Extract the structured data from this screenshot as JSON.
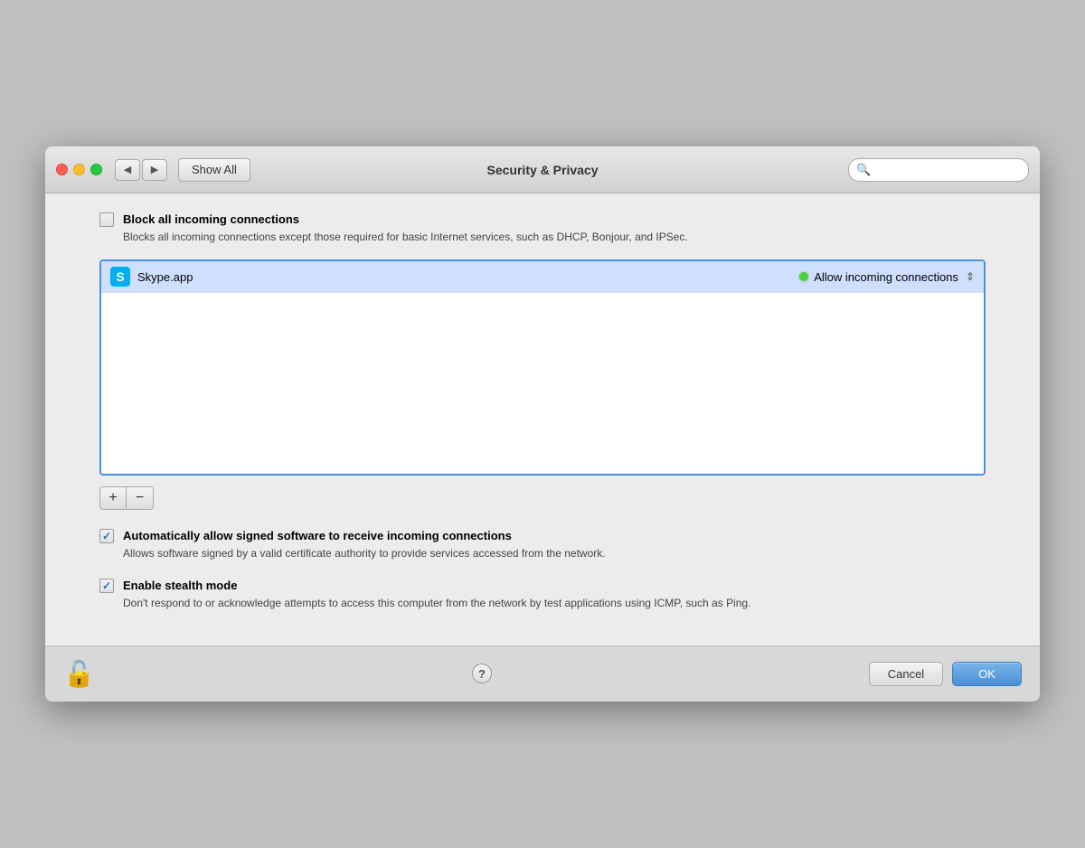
{
  "window": {
    "title": "Security & Privacy"
  },
  "titlebar": {
    "show_all_label": "Show All",
    "back_arrow": "◀",
    "forward_arrow": "▶",
    "search_placeholder": ""
  },
  "content": {
    "block_all": {
      "checked": false,
      "label": "Block all incoming connections",
      "description": "Blocks all incoming connections except those required for basic Internet services,\nsuch as DHCP, Bonjour, and IPSec."
    },
    "app_list": {
      "items": [
        {
          "name": "Skype.app",
          "icon_char": "S",
          "status_label": "Allow incoming connections",
          "status_color": "#4cd137"
        }
      ]
    },
    "add_btn_label": "+",
    "remove_btn_label": "−",
    "auto_allow": {
      "checked": true,
      "label": "Automatically allow signed software to receive incoming connections",
      "description": "Allows software signed by a valid certificate authority to provide services accessed\nfrom the network."
    },
    "stealth": {
      "checked": true,
      "label": "Enable stealth mode",
      "description": "Don't respond to or acknowledge attempts to access this computer from the network\nby test applications using ICMP, such as Ping."
    }
  },
  "footer": {
    "help_label": "?",
    "cancel_label": "Cancel",
    "ok_label": "OK",
    "help_right_label": "?"
  }
}
